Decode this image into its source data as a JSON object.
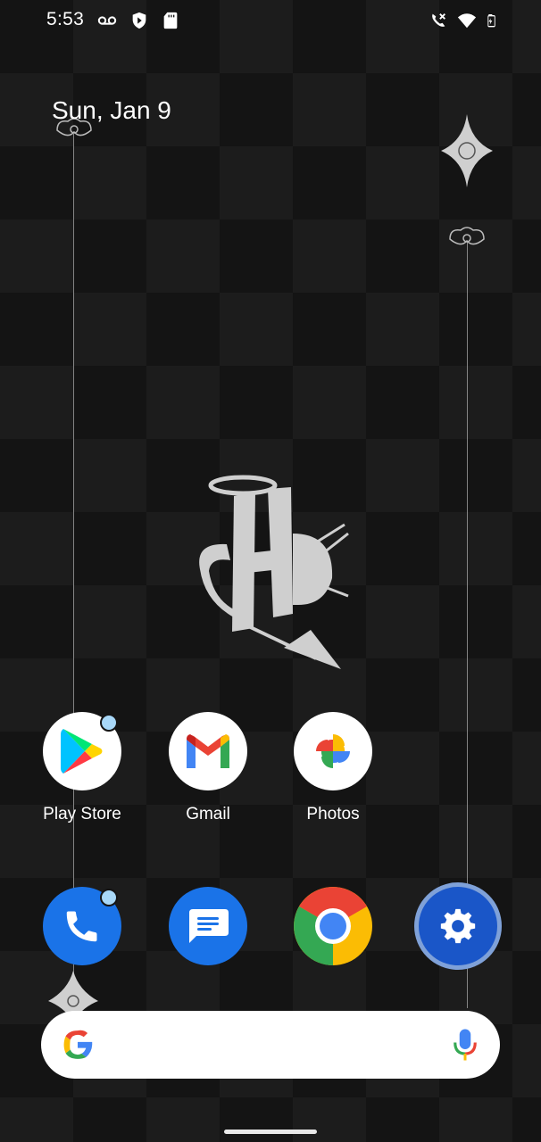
{
  "status_bar": {
    "time": "5:53",
    "left_icons": [
      "voicemail-icon",
      "shield-play-icon",
      "sd-card-icon"
    ],
    "right_icons": [
      "no-call-icon",
      "wifi-icon",
      "battery-charging-icon"
    ]
  },
  "home": {
    "date": "Sun, Jan 9"
  },
  "apps_row": [
    {
      "label": "Play Store",
      "icon": "play-store-icon",
      "notification": true
    },
    {
      "label": "Gmail",
      "icon": "gmail-icon",
      "notification": false
    },
    {
      "label": "Photos",
      "icon": "photos-icon",
      "notification": false
    }
  ],
  "dock": [
    {
      "icon": "phone-icon",
      "notification": true
    },
    {
      "icon": "messages-icon",
      "notification": false
    },
    {
      "icon": "chrome-icon",
      "notification": false
    },
    {
      "icon": "settings-icon",
      "notification": false
    }
  ],
  "search": {
    "logo": "google-g-icon",
    "mic": "mic-icon"
  },
  "colors": {
    "background": "#141414",
    "notification_dot": "#a8d8f8",
    "phone_blue": "#1a73e8",
    "settings_ring": "#7fa1d8"
  }
}
